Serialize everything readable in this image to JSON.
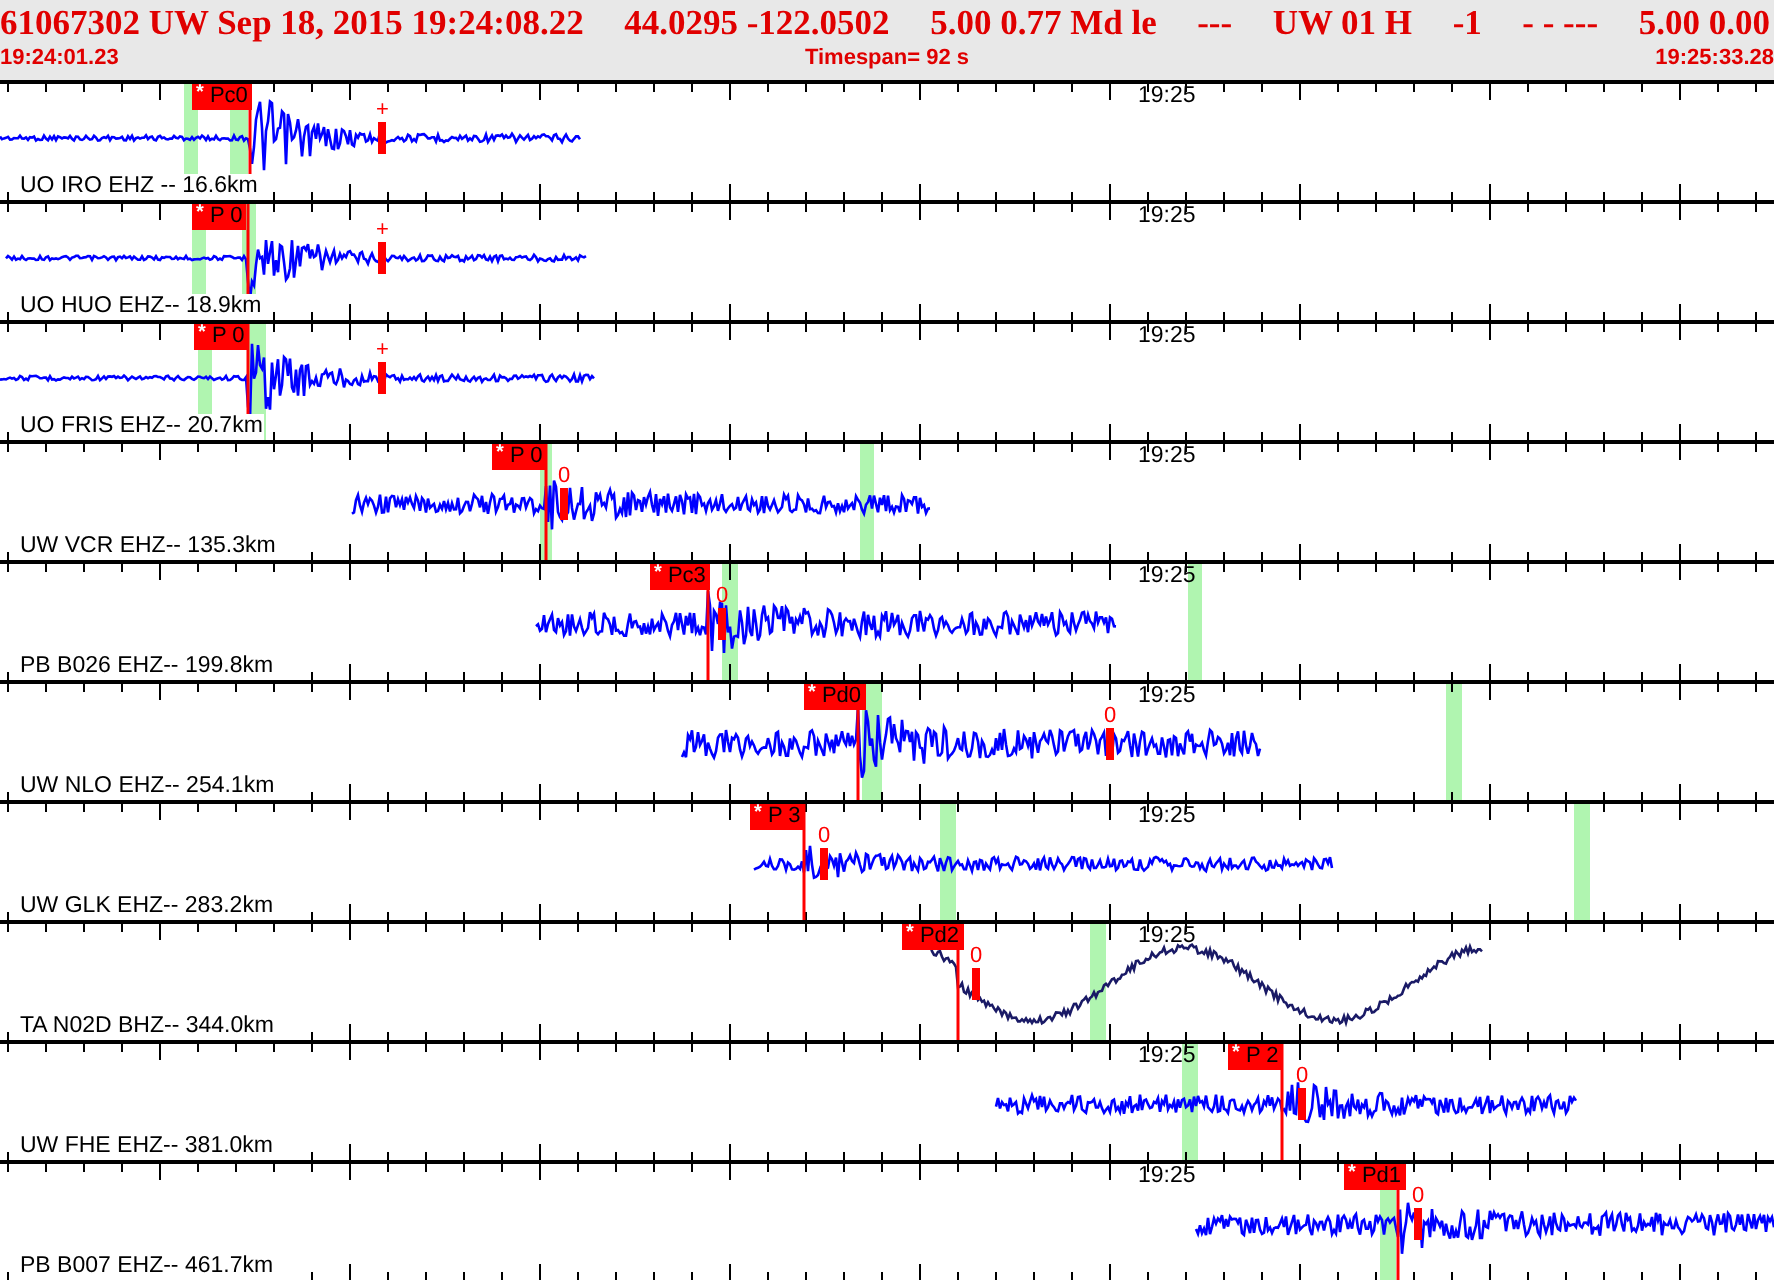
{
  "header": {
    "fields": [
      "61067302 UW Sep 18, 2015 19:24:08.22",
      "44.0295 -122.0502",
      "5.00 0.77 Md le",
      "---",
      "UW 01 H",
      "-1",
      "- - ---",
      "5.00 0.00"
    ],
    "start_time": "19:24:01.23",
    "timespan": "Timespan=  92 s",
    "end_time": "19:25:33.28"
  },
  "channels": [
    {
      "label": "UO IRO EHZ -- 16.6km",
      "pick": "Pc0",
      "pick_mark": "*",
      "coda_mark": "+",
      "time_label": "19:25",
      "color": "#0000ff"
    },
    {
      "label": "UO HUO EHZ-- 18.9km",
      "pick": "P 0",
      "pick_mark": "*",
      "coda_mark": "+",
      "time_label": "19:25",
      "color": "#0000ff"
    },
    {
      "label": "UO FRIS EHZ-- 20.7km",
      "pick": "P 0",
      "pick_mark": "*",
      "coda_mark": "+",
      "time_label": "19:25",
      "color": "#0000ff"
    },
    {
      "label": "UW VCR EHZ-- 135.3km",
      "pick": "P 0",
      "pick_mark": "*",
      "coda_mark": "0",
      "time_label": "19:25",
      "color": "#0000ff"
    },
    {
      "label": "PB B026 EHZ-- 199.8km",
      "pick": "Pc3",
      "pick_mark": "*",
      "coda_mark": "0",
      "time_label": "19:25",
      "color": "#0000ff"
    },
    {
      "label": "UW NLO EHZ-- 254.1km",
      "pick": "Pd0",
      "pick_mark": "*",
      "coda_mark": "0",
      "time_label": "19:25",
      "color": "#0000ff"
    },
    {
      "label": "UW GLK EHZ-- 283.2km",
      "pick": "P 3",
      "pick_mark": "*",
      "coda_mark": "0",
      "time_label": "19:25",
      "color": "#0000ff"
    },
    {
      "label": "TA N02D BHZ-- 344.0km",
      "pick": "Pd2",
      "pick_mark": "*",
      "coda_mark": "0",
      "time_label": "19:25",
      "color": "#1a1a66"
    },
    {
      "label": "UW FHE EHZ-- 381.0km",
      "pick": "P 2",
      "pick_mark": "*",
      "coda_mark": "0",
      "time_label": "19:25",
      "color": "#0000ff"
    },
    {
      "label": "PB B007 EHZ-- 461.7km",
      "pick": "Pd1",
      "pick_mark": "*",
      "coda_mark": "0",
      "time_label": "19:25",
      "color": "#0000ff"
    }
  ]
}
